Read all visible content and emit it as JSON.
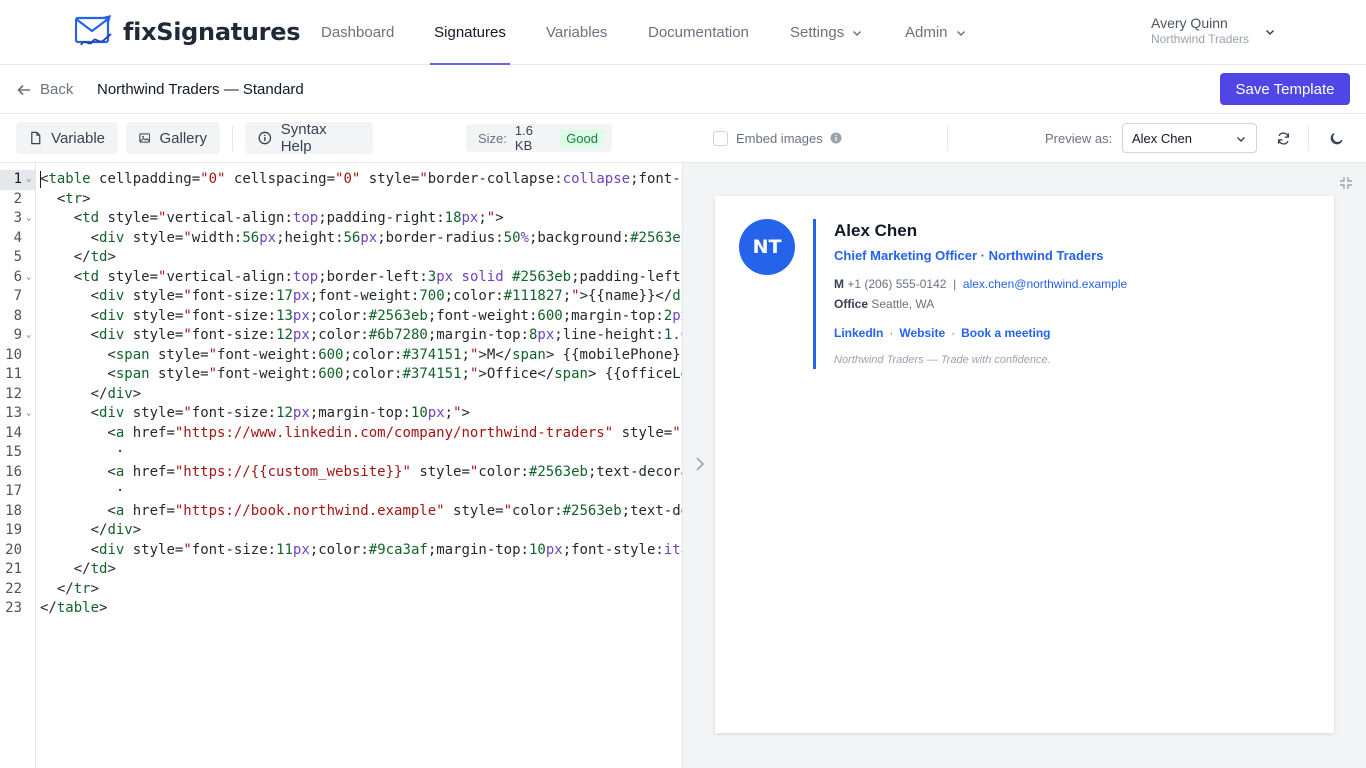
{
  "app": {
    "brand": "fixSignatures"
  },
  "nav": {
    "items": [
      {
        "label": "Dashboard"
      },
      {
        "label": "Signatures"
      },
      {
        "label": "Variables"
      },
      {
        "label": "Documentation"
      },
      {
        "label": "Settings"
      },
      {
        "label": "Admin"
      }
    ],
    "active": "Signatures"
  },
  "user": {
    "name": "Avery Quinn",
    "org": "Northwind Traders"
  },
  "titlebar": {
    "back_label": "Back",
    "template_title": "Northwind Traders — Standard",
    "save_label": "Save Template"
  },
  "toolbar": {
    "variable_label": "Variable",
    "gallery_label": "Gallery",
    "syntax_help_label": "Syntax Help",
    "size_label": "Size:",
    "size_value": "1.6 KB",
    "size_status": "Good",
    "embed_images_label": "Embed images",
    "embed_images_checked": false,
    "preview_as_label": "Preview as:",
    "preview_as_value": "Alex Chen"
  },
  "editor": {
    "active_line": 1,
    "line_numbers": [
      "1",
      "2",
      "3",
      "4",
      "5",
      "6",
      "7",
      "8",
      "9",
      "10",
      "11",
      "12",
      "13",
      "14",
      "15",
      "16",
      "17",
      "18",
      "19",
      "20",
      "21",
      "22",
      "23"
    ],
    "foldable_lines": [
      1,
      3,
      6,
      9,
      13
    ]
  },
  "preview": {
    "avatar_initials": "NT",
    "name": "Alex Chen",
    "role": "Chief Marketing Officer · Northwind Traders",
    "mobile_label": "M",
    "mobile_value": "+1 (206) 555-0142",
    "separator": "|",
    "email": "alex.chen@northwind.example",
    "office_label": "Office",
    "office_value": "Seattle, WA",
    "links": [
      {
        "label": "LinkedIn"
      },
      {
        "label": "Website"
      },
      {
        "label": "Book a meeting"
      }
    ],
    "link_separator": "·",
    "tagline": "Northwind Traders — Trade with confidence."
  },
  "colors": {
    "accent": "#4f46e5",
    "signature_blue": "#2563eb",
    "good_badge_bg": "#dcfce7",
    "good_badge_text": "#15803d"
  },
  "icons": {
    "logo": "envelope-signature-icon",
    "back": "arrow-left-icon",
    "variable": "document-icon",
    "gallery": "image-icon",
    "syntax_help": "info-circle-icon",
    "refresh": "refresh-icon",
    "theme": "moon-icon",
    "expand": "collapse-arrows-icon",
    "panel_toggle": "chevron-right-icon"
  }
}
